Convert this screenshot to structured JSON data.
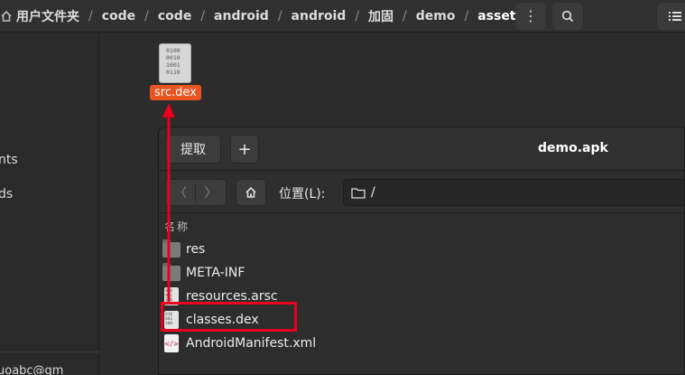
{
  "header": {
    "breadcrumb": [
      "用户文件夹",
      "code",
      "code",
      "android",
      "android",
      "加固",
      "demo",
      "assets"
    ],
    "menu_icon": "kebab-menu-icon",
    "search_icon": "search-icon",
    "view_icon": "list-view-icon"
  },
  "sidebar": {
    "items": [
      "nts",
      "ds"
    ],
    "footer_text": "uoabc@gm"
  },
  "content": {
    "selected_file": "src.dex",
    "selected_file_icon": "binary-file-icon",
    "icon_glyph": "0100\n0010\n1001\n0110"
  },
  "archive_window": {
    "title": "demo.apk",
    "extract_label": "提取",
    "add_label": "+",
    "location_label": "位置(L):",
    "location_value": "/",
    "column_name": "名称",
    "files": [
      {
        "name": "res",
        "icon": "folder"
      },
      {
        "name": "META-INF",
        "icon": "folder"
      },
      {
        "name": "resources.arsc",
        "icon": "binary"
      },
      {
        "name": "classes.dex",
        "icon": "binary"
      },
      {
        "name": "AndroidManifest.xml",
        "icon": "xml"
      }
    ]
  },
  "colors": {
    "accent": "#e95420",
    "annotation": "#e8001c"
  }
}
